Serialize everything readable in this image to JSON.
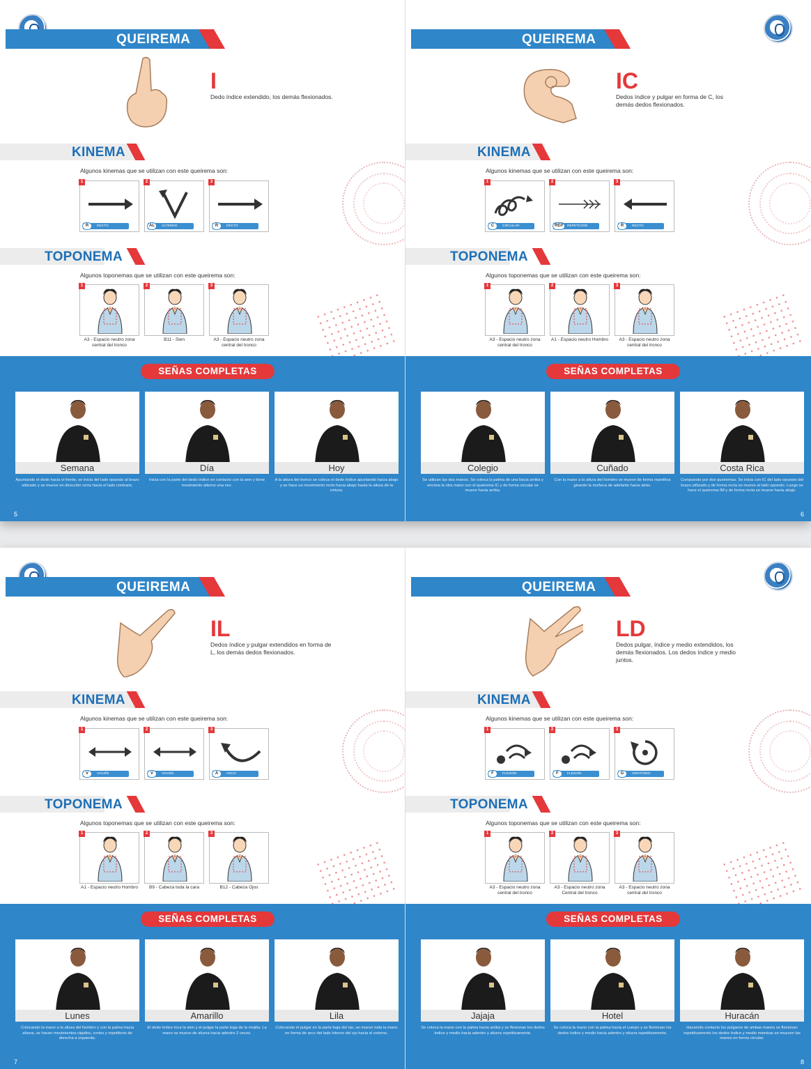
{
  "spreads": [
    {
      "pages": [
        {
          "header": "QUEIREMA",
          "letter": "I",
          "description": "Dedo índice extendido, los demás flexionados.",
          "kinema_title": "KINEMA",
          "kinema_intro": "Algunos kinemas que se utilizan con este queirema son:",
          "kinemas": [
            {
              "num": "1",
              "code": "R",
              "name": "RECTO",
              "icon": "arrow-right"
            },
            {
              "num": "2",
              "code": "AL",
              "name": "ALTERNO",
              "icon": "v-alternating"
            },
            {
              "num": "3",
              "code": "R",
              "name": "RECTO",
              "icon": "arrow-right"
            }
          ],
          "toponema_title": "TOPONEMA",
          "toponema_intro": "Algunos toponemas que se utilizan con este queirema son:",
          "toponemas": [
            {
              "num": "1",
              "caption": "A3 - Espacio neutro zona central del tronco"
            },
            {
              "num": "2",
              "caption": "B11 - Sien"
            },
            {
              "num": "3",
              "caption": "A3 - Espacio neutro zona central del tronco"
            }
          ],
          "complete_title": "SEÑAS COMPLETAS",
          "signs": [
            {
              "word": "Semana",
              "desc": "Apuntando el dedo hacia el frente, se inicia del lado opuesto al brazo utilizado y se mueve en dirección recta hacia el lado contrario."
            },
            {
              "word": "Día",
              "desc": "Inicia con la parte del dedo índice en contacto con la sien y tiene movimiento alterno una vez."
            },
            {
              "word": "Hoy",
              "desc": "A la altura del tronco se coloca el dedo índice apuntando hacia abajo y se hace un movimiento recto hacia abajo hasta la altura de la cintura."
            }
          ],
          "page_number": "5"
        },
        {
          "header": "QUEIREMA",
          "letter": "IC",
          "description": "Dedos índice y pulgar en forma de C, los demás dedos flexionados.",
          "kinema_title": "KINEMA",
          "kinema_intro": "Algunos kinemas que se utilizan con este queirema son:",
          "kinemas": [
            {
              "num": "1",
              "code": "C",
              "name": "CIRCULAR",
              "icon": "circular"
            },
            {
              "num": "2",
              "code": "REP",
              "name": "REPETICIÓN",
              "icon": "arrow-repeat"
            },
            {
              "num": "3",
              "code": "R",
              "name": "RECTO",
              "icon": "arrow-left"
            }
          ],
          "toponema_title": "TOPONEMA",
          "toponema_intro": "Algunos toponemas que se utilizan con este queirema son:",
          "toponemas": [
            {
              "num": "1",
              "caption": "A3 - Espacio neutro zona central del tronco"
            },
            {
              "num": "2",
              "caption": "A1 - Espacio neutro Hombro"
            },
            {
              "num": "3",
              "caption": "A3 - Espacio neutro zona central del tronco"
            }
          ],
          "complete_title": "SEÑAS COMPLETAS",
          "signs": [
            {
              "word": "Colegio",
              "desc": "Se utilizan las dos manos. Se coloca la palma de una hacia arriba y encima la otra mano con el queirema IC y de forma circular se mueve hacia arriba."
            },
            {
              "word": "Cuñado",
              "desc": "Con la mano a la altura del hombro se mueve de forma repetitiva girando la muñeca de adelante hacia atrás."
            },
            {
              "word": "Costa Rica",
              "desc": "Compuesto por dos queiremas. Se inicia con IC del lado opuesto del brazo utilizado y de forma recta se mueve al lado opuesto. Luego se hace el queirema IM y de forma recta se mueve hacia abajo."
            }
          ],
          "page_number": "6"
        }
      ]
    },
    {
      "pages": [
        {
          "header": "QUEIREMA",
          "letter": "IL",
          "description": "Dedos índice y pulgar extendidos en forma de L, los demás dedos flexionados.",
          "kinema_title": "KINEMA",
          "kinema_intro": "Algunos kinemas que se utilizan con este queirema son:",
          "kinemas": [
            {
              "num": "1",
              "code": "V",
              "name": "VAIVÉN",
              "icon": "double-arrow"
            },
            {
              "num": "2",
              "code": "V",
              "name": "VAIVÉN",
              "icon": "double-arrow"
            },
            {
              "num": "3",
              "code": "A",
              "name": "ARCO",
              "icon": "arc"
            }
          ],
          "toponema_title": "TOPONEMA",
          "toponema_intro": "Algunos toponemas que se utilizan con este queirema son:",
          "toponemas": [
            {
              "num": "1",
              "caption": "A1 - Espacio neutro Hombro"
            },
            {
              "num": "2",
              "caption": "B9 - Cabeza toda la cara"
            },
            {
              "num": "3",
              "caption": "B12 - Cabeza Ojos"
            }
          ],
          "complete_title": "SEÑAS COMPLETAS",
          "signs": [
            {
              "word": "Lunes",
              "desc": "Colocando la mano a la altura del hombro y con la palma hacia afuera, se hacen movimientos rápidos, cortos y repetitivos de derecha a izquierda."
            },
            {
              "word": "Amarillo",
              "desc": "El dedo índice toca la sien y el pulgar la parte baja de la mejilla. La mano se mueve de afuera hacia adentro 2 veces."
            },
            {
              "word": "Lila",
              "desc": "Colocando el pulgar en la parte baja del ojo, se mueve toda la mano en forma de arco del lado interno del ojo hacia el externo."
            }
          ],
          "page_number": "7"
        },
        {
          "header": "QUEIREMA",
          "letter": "LD",
          "description": "Dedos pulgar, índice y medio extendidos, los demás flexionados. Los dedos índice y medio juntos.",
          "kinema_title": "KINEMA",
          "kinema_intro": "Algunos kinemas que se utilizan con este queirema son:",
          "kinemas": [
            {
              "num": "1",
              "code": "F",
              "name": "FLEXIÓN",
              "icon": "flexion"
            },
            {
              "num": "2",
              "code": "F",
              "name": "FLEXIÓN",
              "icon": "flexion"
            },
            {
              "num": "3",
              "code": "G",
              "name": "GIRATORIO",
              "icon": "rotate"
            }
          ],
          "toponema_title": "TOPONEMA",
          "toponema_intro": "Algunos toponemas que se utilizan con este queirema son:",
          "toponemas": [
            {
              "num": "1",
              "caption": "A3 - Espacio neutro zona central del tronco"
            },
            {
              "num": "2",
              "caption": "A3 - Espacio neutro zona Central del tronco"
            },
            {
              "num": "3",
              "caption": "A3 - Espacio neutro zona central del tronco"
            }
          ],
          "complete_title": "SEÑAS COMPLETAS",
          "signs": [
            {
              "word": "Jajaja",
              "desc": "Se coloca la mano con la palma hacia arriba y se flexionan los dedos índice y medio hacia adentro y afuera repetitivamente."
            },
            {
              "word": "Hotel",
              "desc": "Se coloca la mano con la palma hacia el cuerpo y se flexionan los dedos índice y medio hacia adentro y afuera repetitivamente."
            },
            {
              "word": "Huracán",
              "desc": "Haciendo contacto los pulgares de ambas manos se flexionan repetitivamente los dedos índice y medio mientras se mueven las manos en forma circular."
            }
          ],
          "page_number": "8"
        }
      ]
    }
  ],
  "colors": {
    "blue": "#2f86c9",
    "red": "#e4383b",
    "title_blue": "#1d6fb6"
  }
}
